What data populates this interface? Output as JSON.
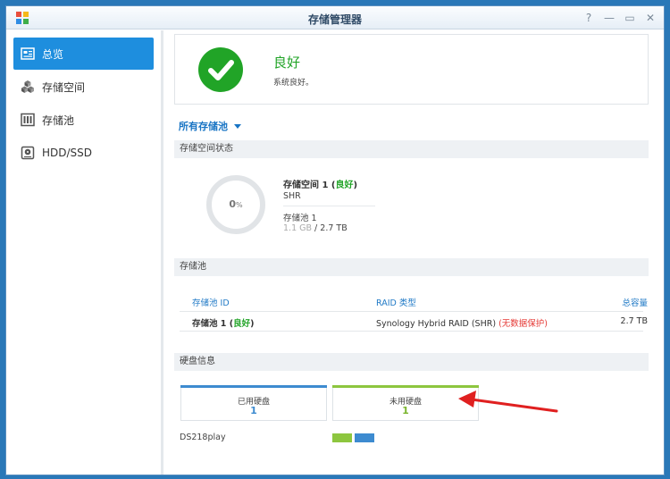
{
  "window": {
    "title": "存储管理器",
    "controls": [
      "?",
      "—",
      "▭",
      "✕"
    ]
  },
  "sidebar": {
    "items": [
      {
        "label": "总览",
        "icon": "overview-icon",
        "active": true
      },
      {
        "label": "存储空间",
        "icon": "cubes-icon",
        "active": false
      },
      {
        "label": "存储池",
        "icon": "pool-icon",
        "active": false
      },
      {
        "label": "HDD/SSD",
        "icon": "hdd-icon",
        "active": false
      }
    ]
  },
  "status": {
    "title": "良好",
    "subtitle": "系统良好。",
    "icon": "check-icon"
  },
  "filter": {
    "label": "所有存储池"
  },
  "volume_section": {
    "title": "存储空间状态",
    "usage_percent": 0,
    "usage_value": "0",
    "usage_unit": "%",
    "volume_name": "存储空间 1",
    "volume_status": "良好",
    "volume_type": "SHR",
    "pool_name": "存储池 1",
    "used": "1.1 GB",
    "separator": "/",
    "total": "2.7 TB"
  },
  "pool_section": {
    "title": "存储池",
    "headers": {
      "id": "存储池 ID",
      "raid": "RAID 类型",
      "capacity": "总容量"
    },
    "rows": [
      {
        "id": "存储池 1",
        "status": "良好",
        "raid": "Synology Hybrid RAID (SHR)",
        "note": "(无数据保护)",
        "capacity": "2.7 TB"
      }
    ]
  },
  "disk_section": {
    "title": "硬盘信息",
    "used_label": "已用硬盘",
    "used_count": "1",
    "unused_label": "未用硬盘",
    "unused_count": "1",
    "device": "DS218play"
  },
  "colors": {
    "accent": "#1e8ede",
    "good": "#21a427",
    "warn": "#e53935",
    "used_disk": "#3d8bd0",
    "unused_disk": "#8dc63f",
    "annotation_arrow": "#e02020"
  }
}
